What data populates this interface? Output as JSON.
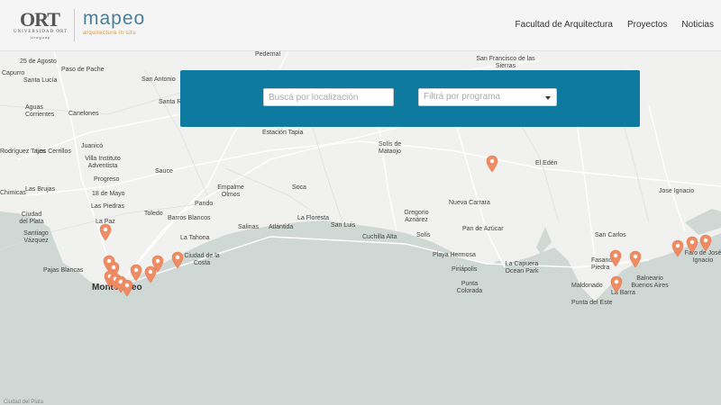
{
  "header": {
    "ort_logo": "ORT",
    "ort_sub": "UNIVERSIDAD ORT",
    "ort_country": "Uruguay",
    "app_title": "mapeo",
    "app_subtitle": "arquitectura in situ",
    "nav": [
      "Facultad de Arquitectura",
      "Proyectos",
      "Noticias"
    ]
  },
  "search": {
    "location_placeholder": "Buscá por localización",
    "program_placeholder": "Filtrá por programa"
  },
  "map_labels": {
    "places": [
      "25 de Agosto",
      "Paso de Pache",
      "Capurro",
      "Santa Lucía",
      "Aguas Corrientes",
      "Canelones",
      "San Antonio",
      "Santa Rosa",
      "Pedernal",
      "San Francisco de las Sierras",
      "Juanicó",
      "Villa Instituto Adventista",
      "Rodríguez Tajes",
      "Los Cerrillos",
      "Progreso",
      "Sauce",
      "Estación Tapia",
      "Solís de Mataojo",
      "El Edén",
      "Las Brujas",
      "18 de Mayo",
      "Las Piedras",
      "Toledo",
      "Pando",
      "Empalme Olmos",
      "Soca",
      "Nueva Carrara",
      "Jose Ignacio",
      "Ciudad del Plata",
      "Santiago Vázquez",
      "La Paz",
      "Barros Blancos",
      "La Floresta",
      "Gregorio Aznárez",
      "La Tahona",
      "Salinas",
      "Atlántida",
      "San Luis",
      "Cuchilla Alta",
      "Solís",
      "Pan de Azúcar",
      "San Carlos",
      "Ciudad de la Costa",
      "Playa Hermosa",
      "Piriápolis",
      "La Capuera Ocean Park",
      "Punta Colorada",
      "Fasano Piedra",
      "Balneario Buenos Aires",
      "Faro de José Ignacio",
      "Pajas Blancas",
      "Maldonado",
      "La Barra",
      "Punta del Este",
      "Montevideo",
      "Chimicas"
    ]
  },
  "footer": {
    "credit": "Ciudad del Plata"
  },
  "colors": {
    "header_bg": "#f5f5f5",
    "panel": "#0f7aa0",
    "water": "#cfd8d4",
    "land": "#f1f1ef",
    "pin": "#f08c63"
  }
}
